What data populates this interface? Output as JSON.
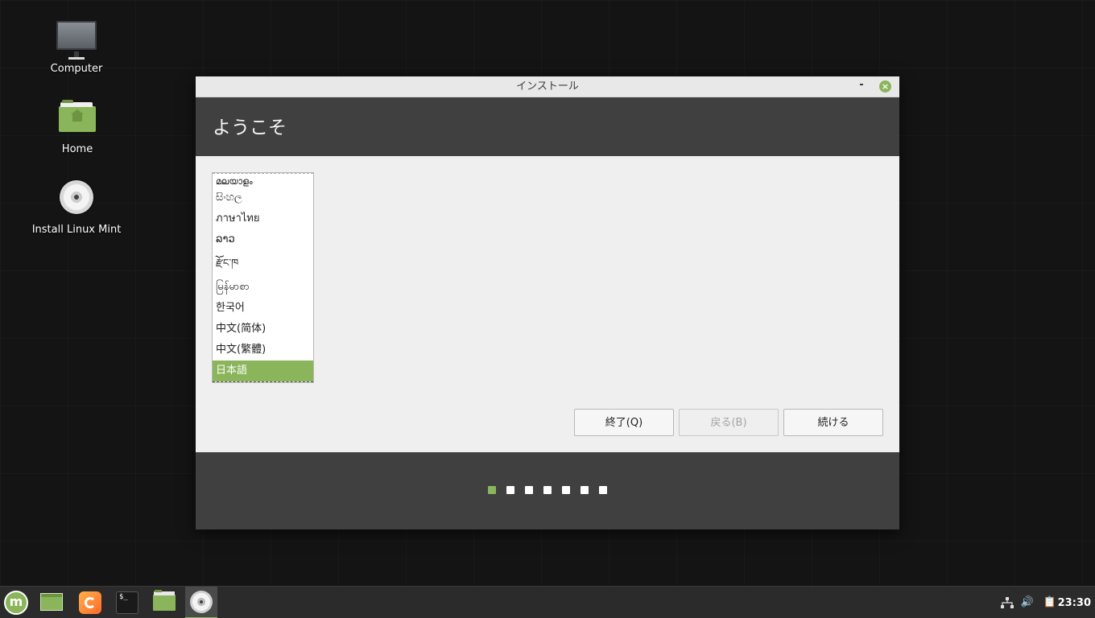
{
  "desktop": {
    "icons": [
      {
        "label": "Computer",
        "icon": "computer-icon"
      },
      {
        "label": "Home",
        "icon": "home-folder-icon"
      },
      {
        "label": "Install Linux Mint",
        "icon": "disc-icon"
      }
    ]
  },
  "window": {
    "title": "インストール",
    "minimize_glyph": "-",
    "close_glyph": "×",
    "header_title": "ようこそ",
    "languages": [
      "മലയാളം",
      "සිංහල",
      "ภาษาไทย",
      "ລາວ",
      "རྫོང་ཁ",
      "မြန်မာစာ",
      "한국어",
      "中文(简体)",
      "中文(繁體)",
      "日本語"
    ],
    "selected_language": "日本語",
    "buttons": {
      "quit": "終了(Q)",
      "back": "戻る(B)",
      "continue": "続ける"
    },
    "progress": {
      "total_steps": 7,
      "current_step": 1
    }
  },
  "taskbar": {
    "launchers": [
      "menu-icon",
      "show-desktop-icon",
      "firefox-icon",
      "terminal-icon",
      "files-icon",
      "installer-icon"
    ],
    "active_launcher": "installer-icon",
    "terminal_glyph": "$_",
    "tray": [
      "network-icon",
      "volume-icon",
      "clipboard-icon"
    ],
    "volume_glyph": "🔊",
    "clipboard_glyph": "📋",
    "clock": "23:30"
  },
  "colors": {
    "accent": "#8ab55a",
    "header_bg": "#404040",
    "window_bg": "#efefef",
    "desktop_bg": "#141414"
  }
}
